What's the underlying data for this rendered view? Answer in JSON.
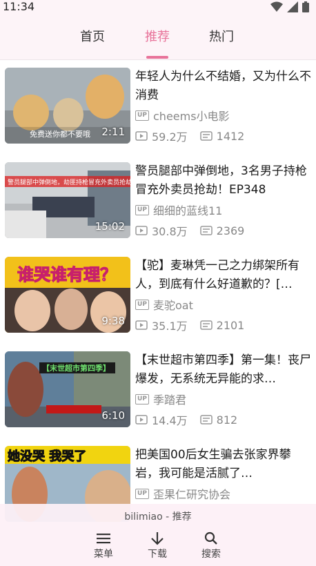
{
  "status": {
    "time": "11:34"
  },
  "tabs": [
    {
      "label": "首页",
      "active": false
    },
    {
      "label": "推荐",
      "active": true
    },
    {
      "label": "热门",
      "active": false
    }
  ],
  "videos": [
    {
      "title": "年轻人为什么不结婚，又为什么不消费",
      "uploader": "cheems小电影",
      "views": "59.2万",
      "danmaku": "1412",
      "duration": "2:11",
      "thumb_caption": "免费送你都不要哦"
    },
    {
      "title": "警员腿部中弹倒地，3名男子持枪冒充外卖员抢劫！EP348",
      "uploader": "细细的蓝线11",
      "views": "30.8万",
      "danmaku": "2369",
      "duration": "15:02",
      "thumb_caption": "警员腿部中弹倒地，劫匪持枪冒充外卖员抢劫"
    },
    {
      "title": "【驼】麦琳凭一己之力绑架所有人，到底有什么好道歉的？[…",
      "uploader": "麦驼oat",
      "views": "35.1万",
      "danmaku": "2101",
      "duration": "9:38",
      "thumb_caption": "谁哭谁有理？"
    },
    {
      "title": "【末世超市第四季】第一集！丧尸爆发，无系统无异能的求…",
      "uploader": "季踏君",
      "views": "14.4万",
      "danmaku": "812",
      "duration": "6:10",
      "thumb_caption": "【末世超市第四季】"
    },
    {
      "title": "把美国00后女生骗去张家界攀岩，我可能是活腻了…",
      "uploader": "歪果仁研究协会",
      "views": "",
      "danmaku": "",
      "duration": "",
      "thumb_caption": "她没哭 我哭了"
    }
  ],
  "bottom": {
    "app_name": "bilimiao - 推荐",
    "nav": [
      {
        "label": "菜单",
        "icon": "menu-icon"
      },
      {
        "label": "下载",
        "icon": "download-icon"
      },
      {
        "label": "搜索",
        "icon": "search-icon"
      }
    ]
  },
  "colors": {
    "accent": "#e8739a",
    "bg_bar": "#fdf4f8"
  }
}
